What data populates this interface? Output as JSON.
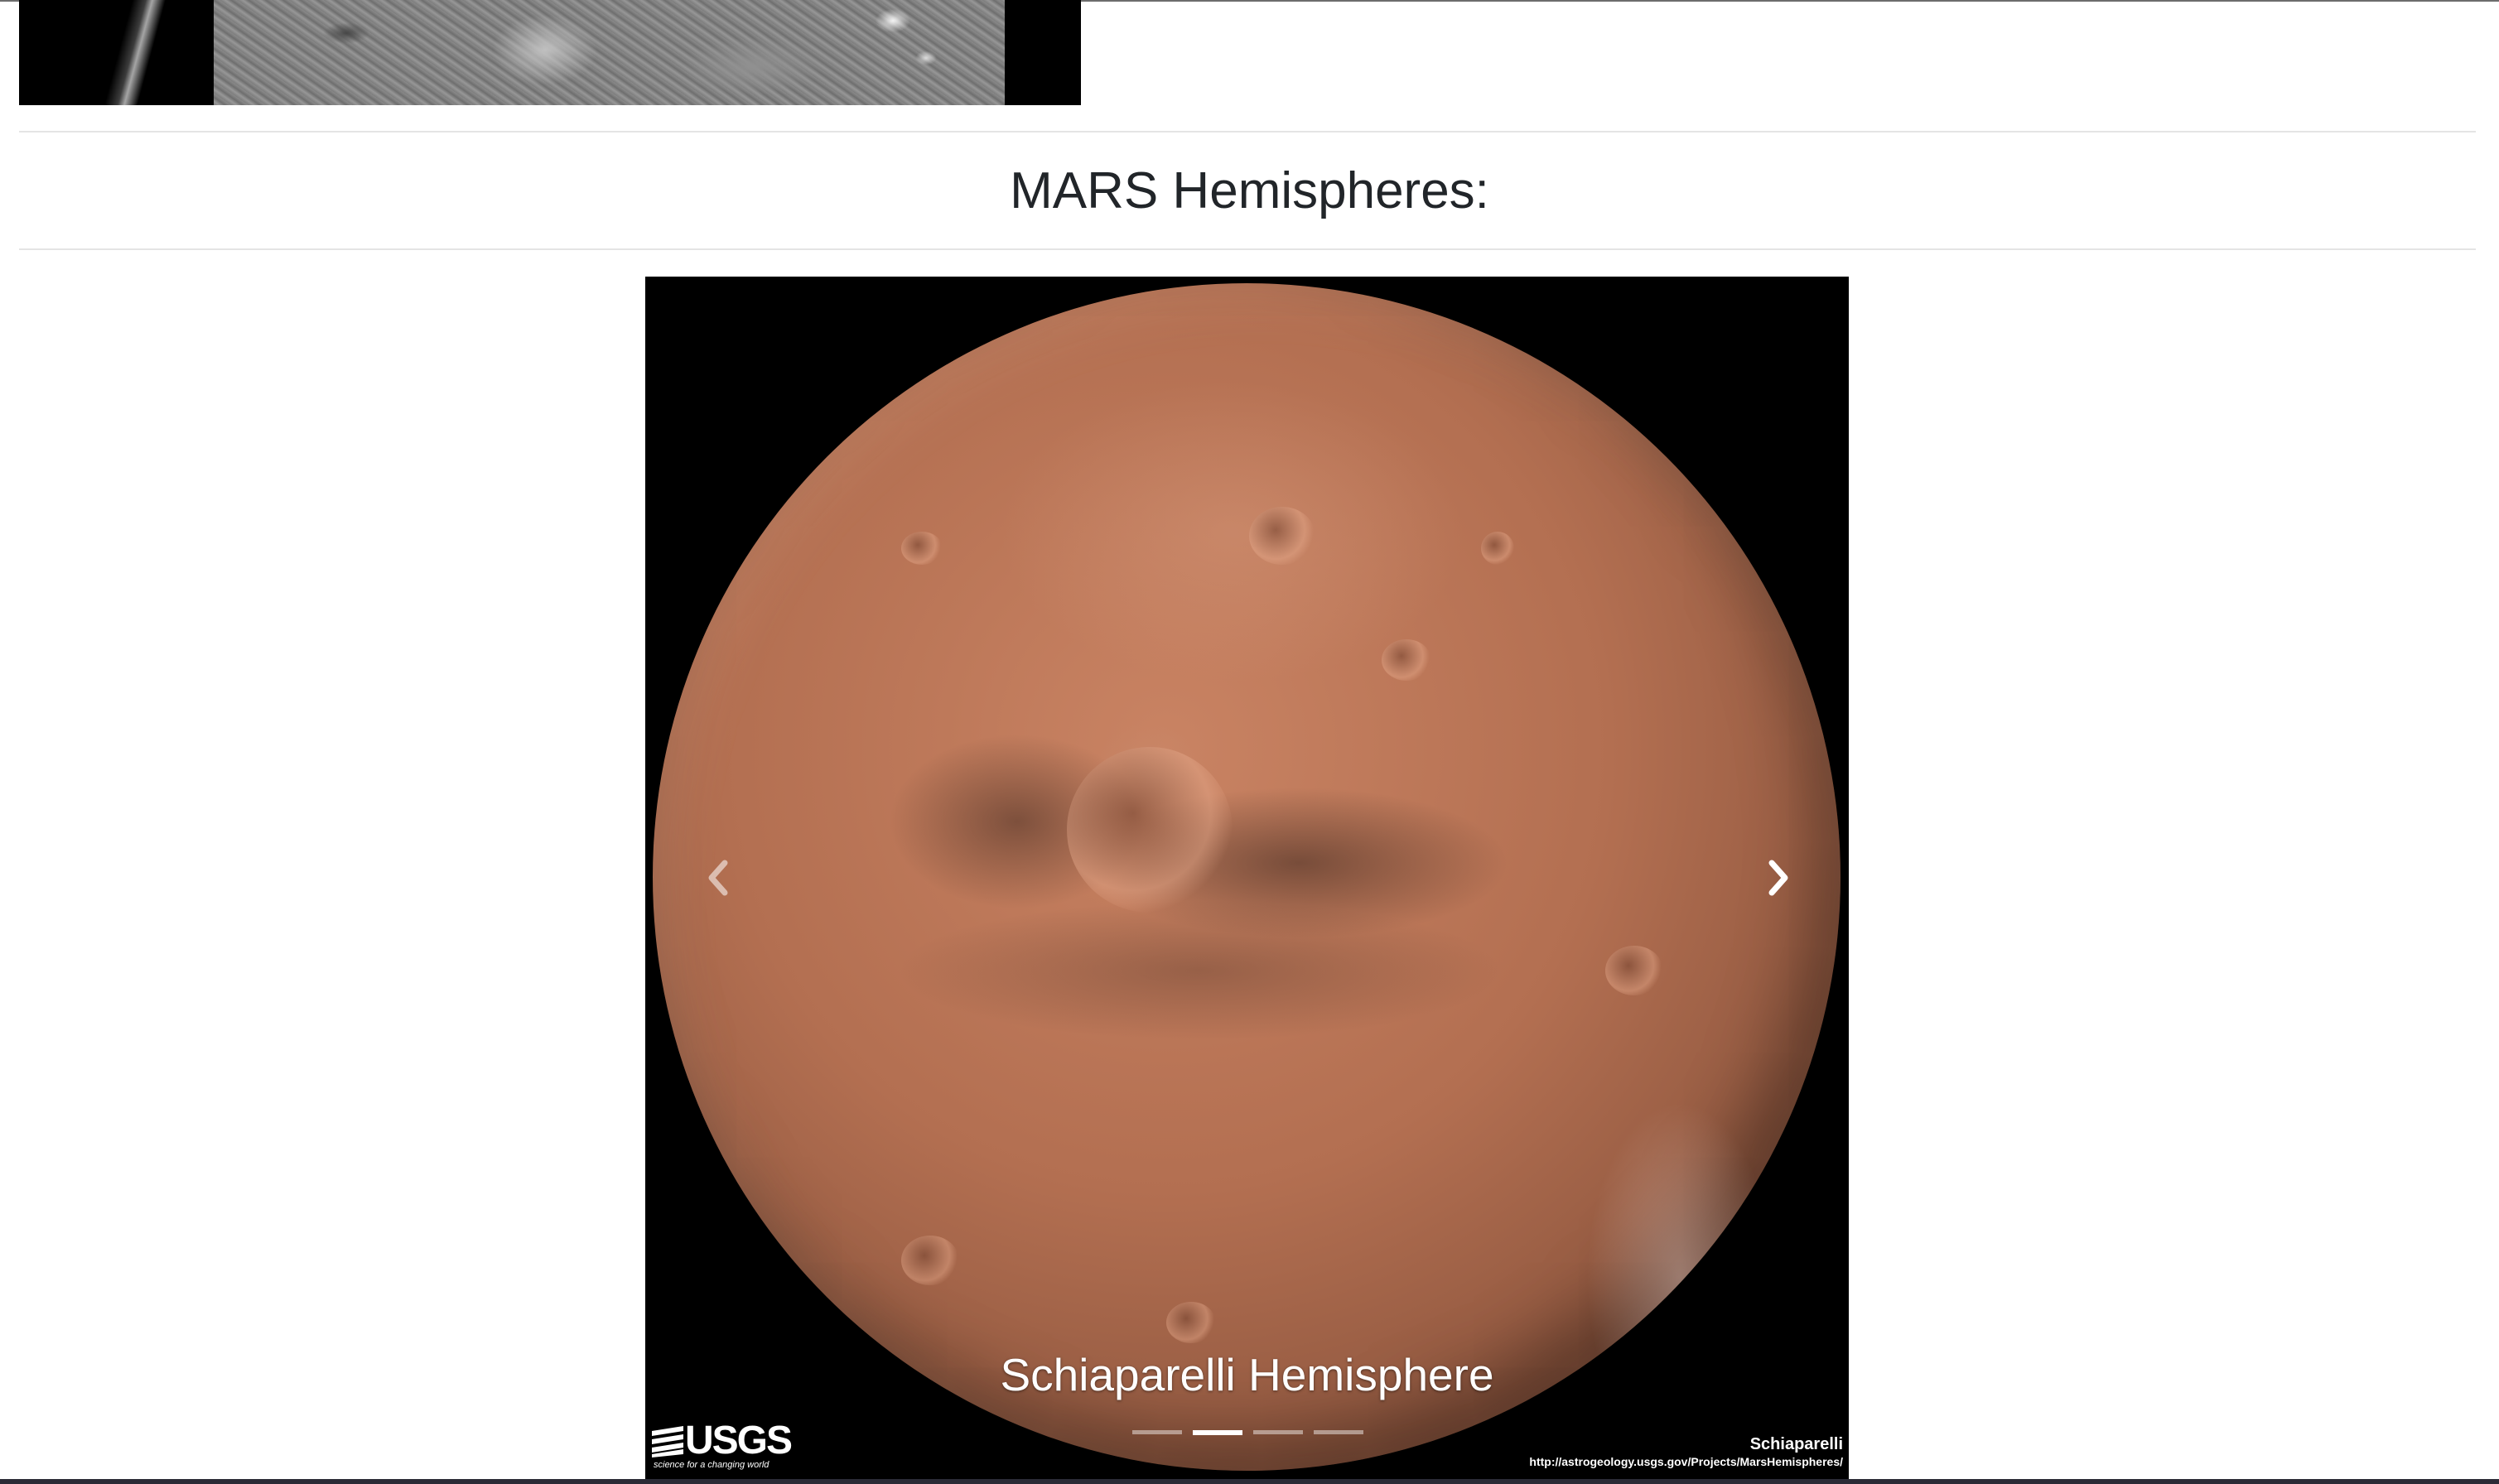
{
  "hemispheres_section": {
    "title": "MARS Hemispheres:"
  },
  "carousel": {
    "active_slide": {
      "caption": "Schiaparelli Hemisphere",
      "image_label": "Schiaparelli",
      "image_url_text": "http://astrogeology.usgs.gov/Projects/MarsHemispheres/"
    },
    "logo": {
      "wordmark": "USGS",
      "tagline": "science for a changing world"
    },
    "indicators": [
      {
        "active": false
      },
      {
        "active": true
      },
      {
        "active": false
      },
      {
        "active": false
      }
    ],
    "active_index": 1,
    "prev_icon": "chevron-left-icon",
    "next_icon": "chevron-right-icon"
  },
  "colors": {
    "heading": "#212529",
    "divider": "#e4e4e4",
    "carousel_bg": "#000000",
    "caption": "#ffffff"
  }
}
